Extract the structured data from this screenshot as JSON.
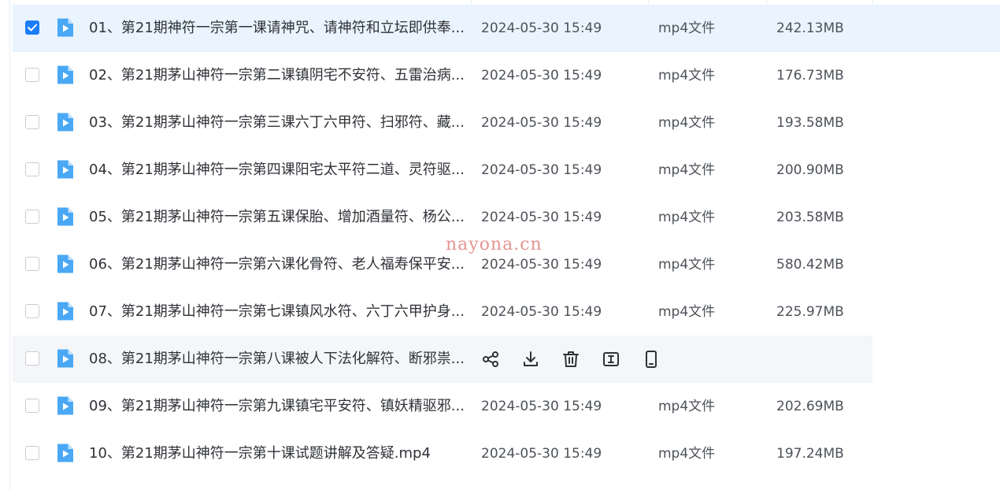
{
  "files": [
    {
      "name": "01、第21期神符一宗第一课请神咒、请神符和立坛即供奉...",
      "date": "2024-05-30 15:49",
      "type": "mp4文件",
      "size": "242.13MB",
      "selected": true,
      "hovered": false
    },
    {
      "name": "02、第21期茅山神符一宗第二课镇阴宅不安符、五雷治病...",
      "date": "2024-05-30 15:49",
      "type": "mp4文件",
      "size": "176.73MB",
      "selected": false,
      "hovered": false
    },
    {
      "name": "03、第21期茅山神符一宗第三课六丁六甲符、扫邪符、藏...",
      "date": "2024-05-30 15:49",
      "type": "mp4文件",
      "size": "193.58MB",
      "selected": false,
      "hovered": false
    },
    {
      "name": "04、第21期茅山神符一宗第四课阳宅太平符二道、灵符驱...",
      "date": "2024-05-30 15:49",
      "type": "mp4文件",
      "size": "200.90MB",
      "selected": false,
      "hovered": false
    },
    {
      "name": "05、第21期茅山神符一宗第五课保胎、增加酒量符、杨公...",
      "date": "2024-05-30 15:49",
      "type": "mp4文件",
      "size": "203.58MB",
      "selected": false,
      "hovered": false
    },
    {
      "name": "06、第21期茅山神符一宗第六课化骨符、老人福寿保平安...",
      "date": "2024-05-30 15:49",
      "type": "mp4文件",
      "size": "580.42MB",
      "selected": false,
      "hovered": false
    },
    {
      "name": "07、第21期茅山神符一宗第七课镇风水符、六丁六甲护身...",
      "date": "2024-05-30 15:49",
      "type": "mp4文件",
      "size": "225.97MB",
      "selected": false,
      "hovered": false
    },
    {
      "name": "08、第21期茅山神符一宗第八课被人下法化解符、断邪祟...",
      "date": "",
      "type": "",
      "size": "",
      "selected": false,
      "hovered": true
    },
    {
      "name": "09、第21期茅山神符一宗第九课镇宅平安符、镇妖精驱邪...",
      "date": "2024-05-30 15:49",
      "type": "mp4文件",
      "size": "202.69MB",
      "selected": false,
      "hovered": false
    },
    {
      "name": "10、第21期茅山神符一宗第十课试题讲解及答疑.mp4",
      "date": "2024-05-30 15:49",
      "type": "mp4文件",
      "size": "197.24MB",
      "selected": false,
      "hovered": false
    }
  ],
  "hover_actions": [
    "share-icon",
    "download-icon",
    "delete-icon",
    "rename-icon",
    "phone-icon"
  ],
  "watermark": "nayona.cn",
  "colors": {
    "accent": "#1b7df8",
    "selected_row_bg": "#e9f4fe",
    "hover_row_bg": "#f5f6f8",
    "file_icon": "#4aa8f5",
    "watermark": "#e0837f"
  }
}
